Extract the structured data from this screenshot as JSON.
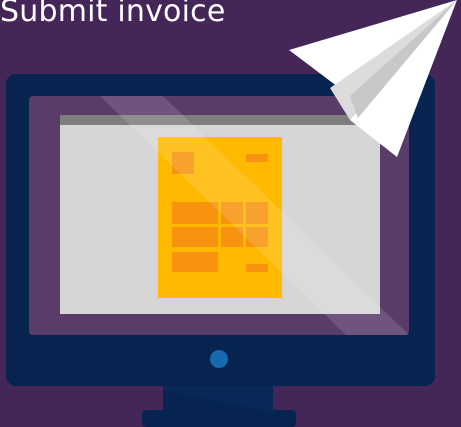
{
  "header": {
    "title": "Submit invoice"
  },
  "colors": {
    "background": "#452658",
    "monitor_frame": "#07234F",
    "screen_bezel": "#5A3C6A",
    "window_body": "#D6D6D6",
    "window_titlebar": "#7E7E7E",
    "invoice_paper": "#FFB900",
    "invoice_blocks": "#F7930E",
    "power_button": "#1769B2",
    "paper_plane": "#FFFFFF"
  },
  "icons": {
    "monitor": "monitor-icon",
    "invoice": "invoice-document-icon",
    "plane": "paper-plane-icon",
    "power": "power-button-icon"
  }
}
